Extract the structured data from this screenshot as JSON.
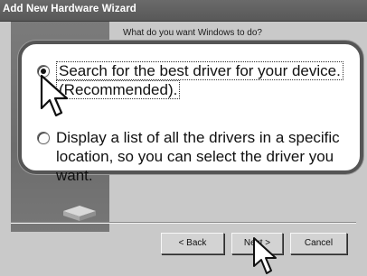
{
  "window": {
    "title": "Add New Hardware Wizard"
  },
  "wizard": {
    "question": "What do you want Windows to do?",
    "options": [
      {
        "line1": "Search for the best driver for your device.",
        "line2": "(Recommended).",
        "selected": true
      },
      {
        "line1": "Display a list of all the drivers in a specific",
        "line2": "location, so you can select the driver you want.",
        "selected": false
      }
    ]
  },
  "buttons": {
    "back": "< Back",
    "next": "Next >",
    "cancel": "Cancel"
  },
  "icons": {
    "pointer": "mouse-pointer-icon"
  },
  "colors": {
    "titlebar": "#5f5f5f",
    "window": "#c9c9c9",
    "callout_border": "#555555",
    "callout_bg": "#ffffff"
  }
}
